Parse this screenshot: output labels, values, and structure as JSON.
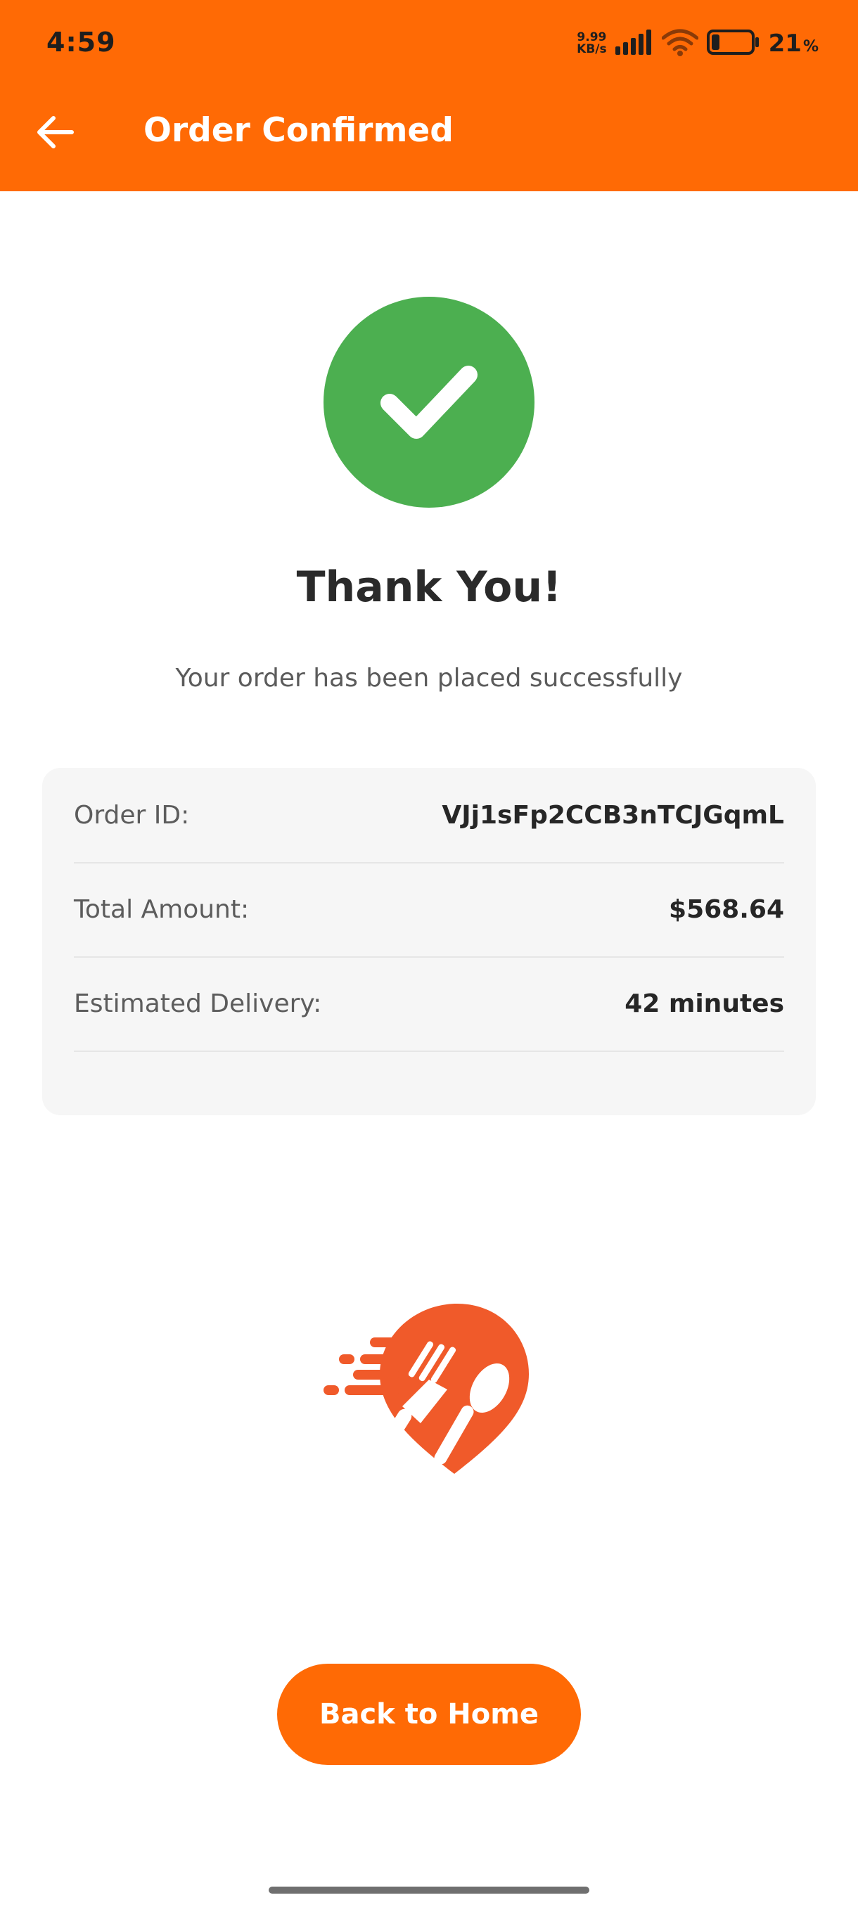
{
  "status_bar": {
    "time": "4:59",
    "net_speed_value": "9.99",
    "net_speed_unit": "KB/s",
    "battery_percent": "21",
    "battery_percent_sign": "%",
    "battery_level": 0.21,
    "icons": [
      "signal-icon",
      "wifi-icon",
      "battery-icon"
    ]
  },
  "header": {
    "title": "Order Confirmed",
    "back_icon": "arrow-left-icon",
    "background_color": "#ff6a05"
  },
  "success": {
    "icon": "checkmark-icon",
    "circle_color": "#4caf50",
    "heading": "Thank You!",
    "message": "Your order has been placed successfully"
  },
  "order_details": [
    {
      "label": "Order ID:",
      "value": "VJj1sFp2CCB3nTCJGqmL"
    },
    {
      "label": "Total Amount:",
      "value": "$568.64"
    },
    {
      "label": "Estimated Delivery:",
      "value": "42 minutes"
    }
  ],
  "logo": {
    "icon": "food-delivery-logo-icon",
    "color": "#f05a2a"
  },
  "actions": {
    "back_to_home_label": "Back to Home",
    "button_color": "#ff6a05"
  }
}
